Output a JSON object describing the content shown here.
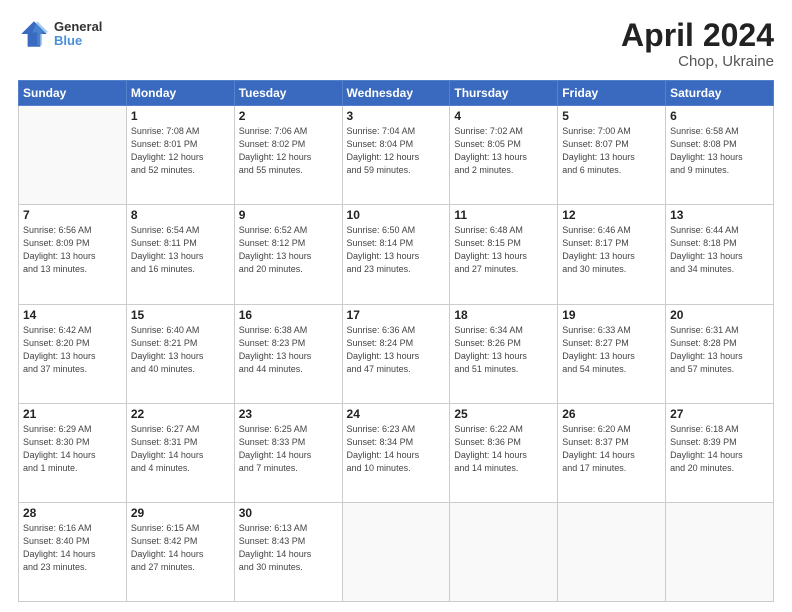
{
  "header": {
    "logo_line1": "General",
    "logo_line2": "Blue",
    "title": "April 2024",
    "subtitle": "Chop, Ukraine"
  },
  "weekdays": [
    "Sunday",
    "Monday",
    "Tuesday",
    "Wednesday",
    "Thursday",
    "Friday",
    "Saturday"
  ],
  "weeks": [
    [
      {
        "num": "",
        "info": ""
      },
      {
        "num": "1",
        "info": "Sunrise: 7:08 AM\nSunset: 8:01 PM\nDaylight: 12 hours\nand 52 minutes."
      },
      {
        "num": "2",
        "info": "Sunrise: 7:06 AM\nSunset: 8:02 PM\nDaylight: 12 hours\nand 55 minutes."
      },
      {
        "num": "3",
        "info": "Sunrise: 7:04 AM\nSunset: 8:04 PM\nDaylight: 12 hours\nand 59 minutes."
      },
      {
        "num": "4",
        "info": "Sunrise: 7:02 AM\nSunset: 8:05 PM\nDaylight: 13 hours\nand 2 minutes."
      },
      {
        "num": "5",
        "info": "Sunrise: 7:00 AM\nSunset: 8:07 PM\nDaylight: 13 hours\nand 6 minutes."
      },
      {
        "num": "6",
        "info": "Sunrise: 6:58 AM\nSunset: 8:08 PM\nDaylight: 13 hours\nand 9 minutes."
      }
    ],
    [
      {
        "num": "7",
        "info": "Sunrise: 6:56 AM\nSunset: 8:09 PM\nDaylight: 13 hours\nand 13 minutes."
      },
      {
        "num": "8",
        "info": "Sunrise: 6:54 AM\nSunset: 8:11 PM\nDaylight: 13 hours\nand 16 minutes."
      },
      {
        "num": "9",
        "info": "Sunrise: 6:52 AM\nSunset: 8:12 PM\nDaylight: 13 hours\nand 20 minutes."
      },
      {
        "num": "10",
        "info": "Sunrise: 6:50 AM\nSunset: 8:14 PM\nDaylight: 13 hours\nand 23 minutes."
      },
      {
        "num": "11",
        "info": "Sunrise: 6:48 AM\nSunset: 8:15 PM\nDaylight: 13 hours\nand 27 minutes."
      },
      {
        "num": "12",
        "info": "Sunrise: 6:46 AM\nSunset: 8:17 PM\nDaylight: 13 hours\nand 30 minutes."
      },
      {
        "num": "13",
        "info": "Sunrise: 6:44 AM\nSunset: 8:18 PM\nDaylight: 13 hours\nand 34 minutes."
      }
    ],
    [
      {
        "num": "14",
        "info": "Sunrise: 6:42 AM\nSunset: 8:20 PM\nDaylight: 13 hours\nand 37 minutes."
      },
      {
        "num": "15",
        "info": "Sunrise: 6:40 AM\nSunset: 8:21 PM\nDaylight: 13 hours\nand 40 minutes."
      },
      {
        "num": "16",
        "info": "Sunrise: 6:38 AM\nSunset: 8:23 PM\nDaylight: 13 hours\nand 44 minutes."
      },
      {
        "num": "17",
        "info": "Sunrise: 6:36 AM\nSunset: 8:24 PM\nDaylight: 13 hours\nand 47 minutes."
      },
      {
        "num": "18",
        "info": "Sunrise: 6:34 AM\nSunset: 8:26 PM\nDaylight: 13 hours\nand 51 minutes."
      },
      {
        "num": "19",
        "info": "Sunrise: 6:33 AM\nSunset: 8:27 PM\nDaylight: 13 hours\nand 54 minutes."
      },
      {
        "num": "20",
        "info": "Sunrise: 6:31 AM\nSunset: 8:28 PM\nDaylight: 13 hours\nand 57 minutes."
      }
    ],
    [
      {
        "num": "21",
        "info": "Sunrise: 6:29 AM\nSunset: 8:30 PM\nDaylight: 14 hours\nand 1 minute."
      },
      {
        "num": "22",
        "info": "Sunrise: 6:27 AM\nSunset: 8:31 PM\nDaylight: 14 hours\nand 4 minutes."
      },
      {
        "num": "23",
        "info": "Sunrise: 6:25 AM\nSunset: 8:33 PM\nDaylight: 14 hours\nand 7 minutes."
      },
      {
        "num": "24",
        "info": "Sunrise: 6:23 AM\nSunset: 8:34 PM\nDaylight: 14 hours\nand 10 minutes."
      },
      {
        "num": "25",
        "info": "Sunrise: 6:22 AM\nSunset: 8:36 PM\nDaylight: 14 hours\nand 14 minutes."
      },
      {
        "num": "26",
        "info": "Sunrise: 6:20 AM\nSunset: 8:37 PM\nDaylight: 14 hours\nand 17 minutes."
      },
      {
        "num": "27",
        "info": "Sunrise: 6:18 AM\nSunset: 8:39 PM\nDaylight: 14 hours\nand 20 minutes."
      }
    ],
    [
      {
        "num": "28",
        "info": "Sunrise: 6:16 AM\nSunset: 8:40 PM\nDaylight: 14 hours\nand 23 minutes."
      },
      {
        "num": "29",
        "info": "Sunrise: 6:15 AM\nSunset: 8:42 PM\nDaylight: 14 hours\nand 27 minutes."
      },
      {
        "num": "30",
        "info": "Sunrise: 6:13 AM\nSunset: 8:43 PM\nDaylight: 14 hours\nand 30 minutes."
      },
      {
        "num": "",
        "info": ""
      },
      {
        "num": "",
        "info": ""
      },
      {
        "num": "",
        "info": ""
      },
      {
        "num": "",
        "info": ""
      }
    ]
  ]
}
